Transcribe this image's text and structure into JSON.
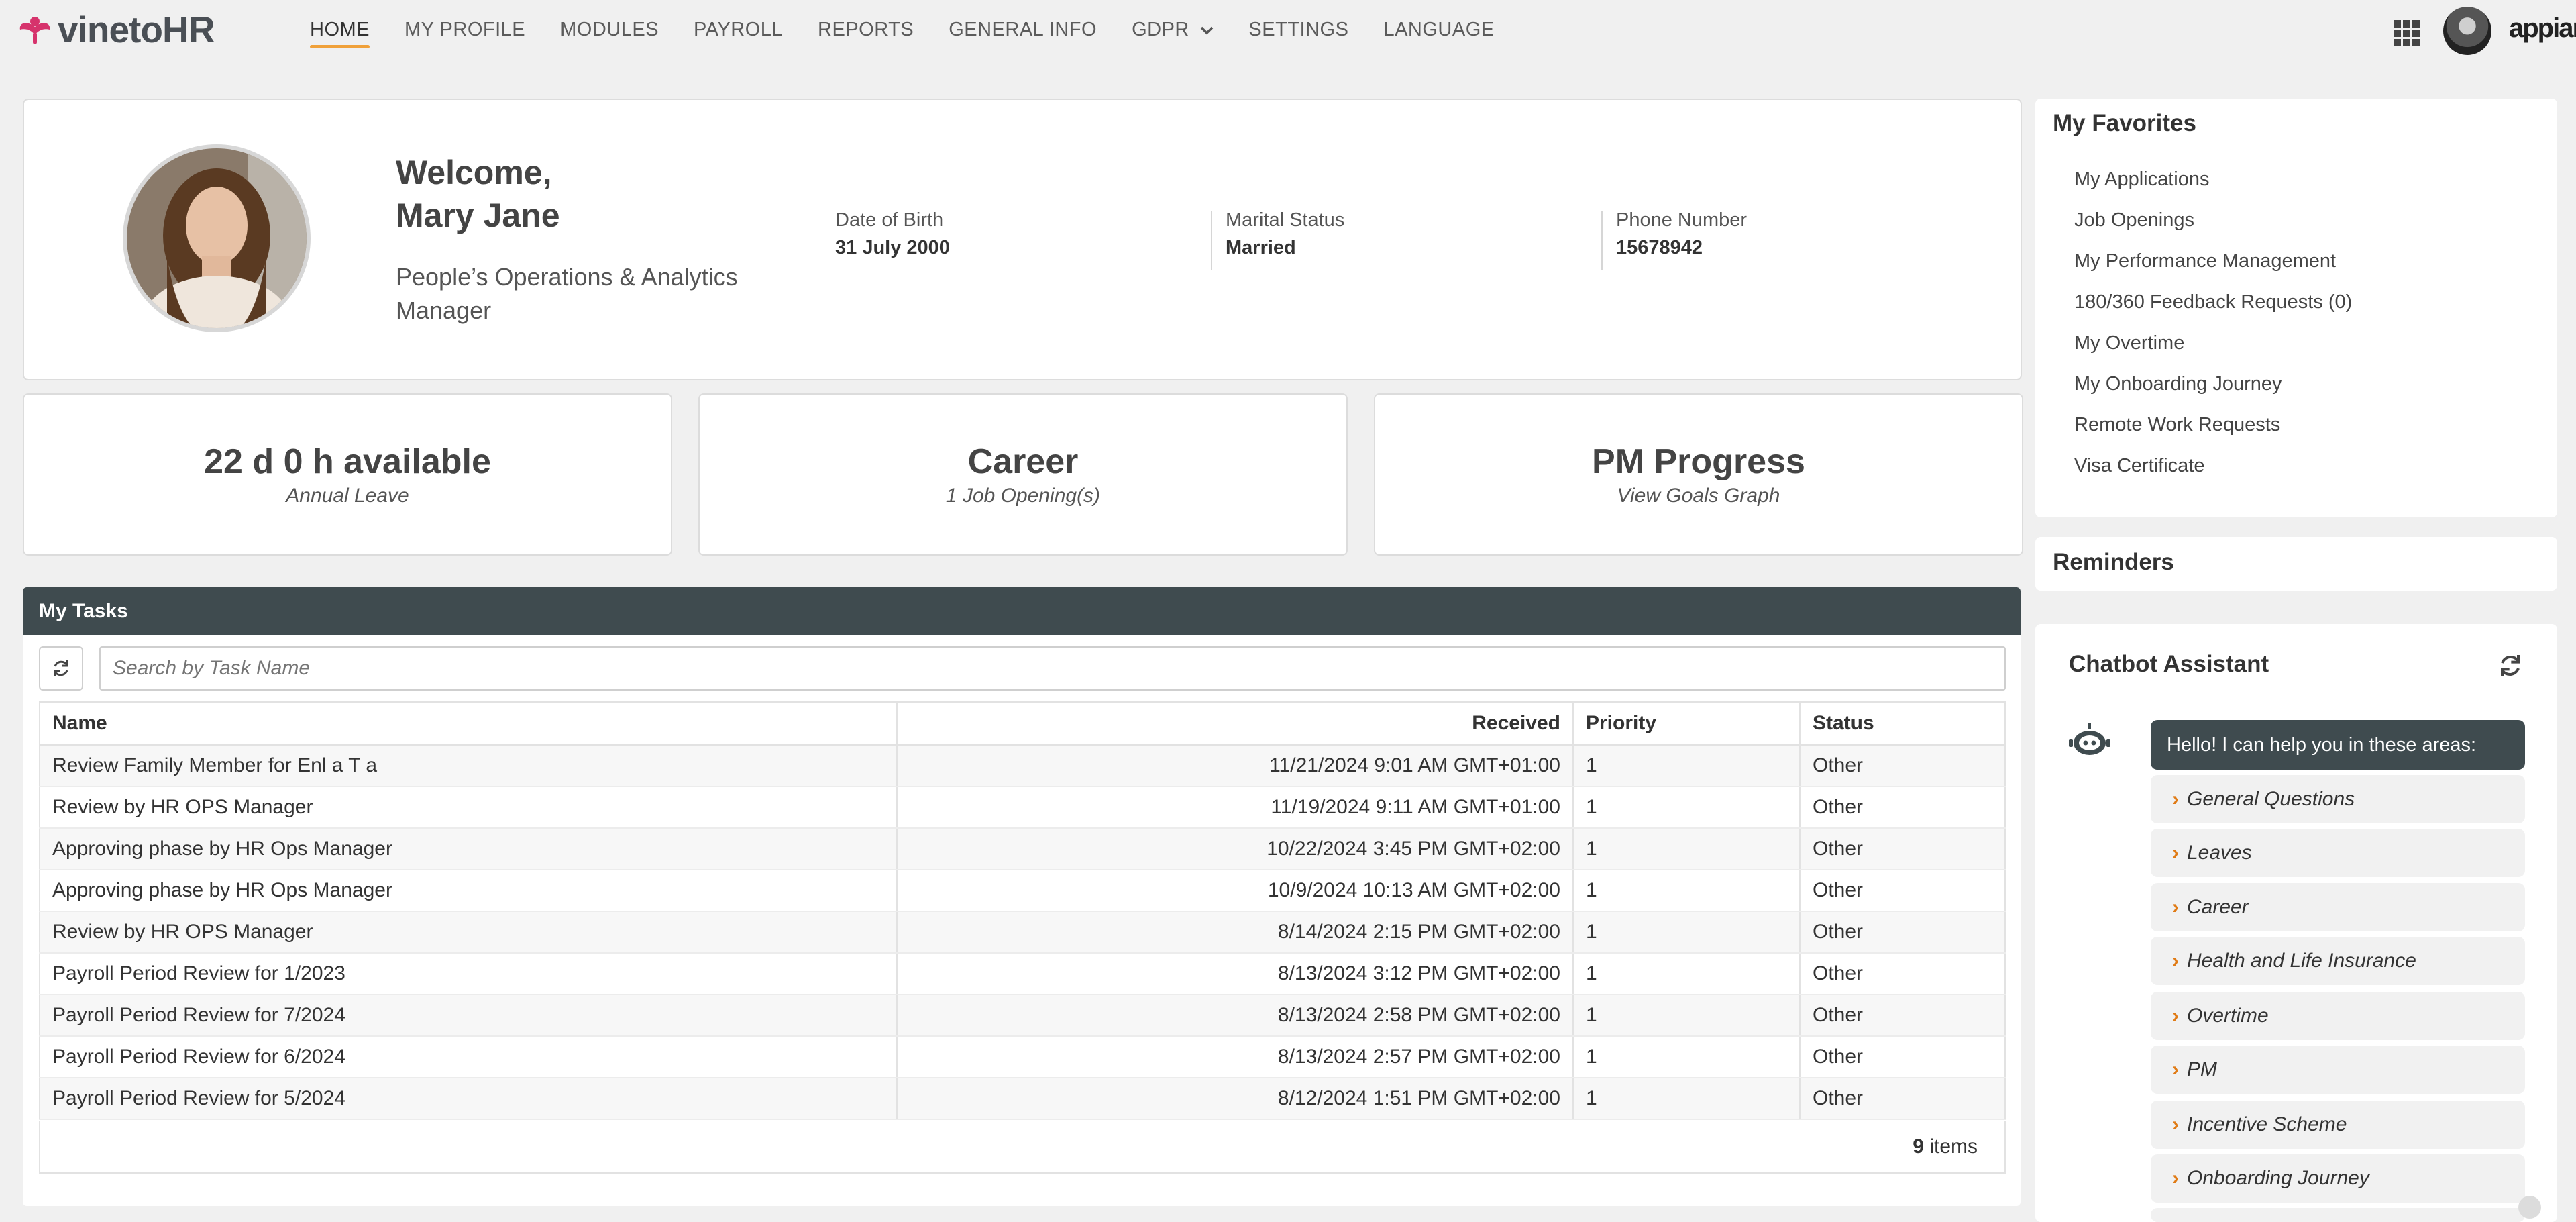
{
  "brand": {
    "name_part1": "vineto",
    "name_part2": "HR",
    "vendor": "appian"
  },
  "nav": [
    {
      "label": "HOME",
      "active": true
    },
    {
      "label": "MY PROFILE"
    },
    {
      "label": "MODULES"
    },
    {
      "label": "PAYROLL"
    },
    {
      "label": "REPORTS"
    },
    {
      "label": "GENERAL INFO"
    },
    {
      "label": "GDPR"
    },
    {
      "label": "SETTINGS"
    },
    {
      "label": "LANGUAGE"
    }
  ],
  "profile": {
    "welcome_line1": "Welcome,",
    "welcome_line2": "Mary Jane",
    "job_title": "People’s Operations & Analytics Manager",
    "fields": [
      {
        "label": "Date of Birth",
        "value": "31 July 2000"
      },
      {
        "label": "Marital Status",
        "value": "Married"
      },
      {
        "label": "Phone Number",
        "value": "15678942"
      }
    ]
  },
  "stats": [
    {
      "title": "22 d 0 h available",
      "subtitle": "Annual Leave"
    },
    {
      "title": "Career",
      "subtitle": "1 Job Opening(s)"
    },
    {
      "title": "PM Progress",
      "subtitle": "View Goals Graph"
    }
  ],
  "tasks": {
    "header": "My Tasks",
    "search_placeholder": "Search by Task Name",
    "columns": [
      "Name",
      "Received",
      "Priority",
      "Status"
    ],
    "rows": [
      {
        "name": "Review Family Member for Enl      a T   a",
        "received": "11/21/2024 9:01 AM GMT+01:00",
        "priority": "1",
        "status": "Other"
      },
      {
        "name": "Review by HR OPS Manager",
        "received": "11/19/2024 9:11 AM GMT+01:00",
        "priority": "1",
        "status": "Other"
      },
      {
        "name": "Approving phase by HR Ops Manager",
        "received": "10/22/2024 3:45 PM GMT+02:00",
        "priority": "1",
        "status": "Other"
      },
      {
        "name": "Approving phase by HR Ops Manager",
        "received": "10/9/2024 10:13 AM GMT+02:00",
        "priority": "1",
        "status": "Other"
      },
      {
        "name": "Review by HR OPS Manager",
        "received": "8/14/2024 2:15 PM GMT+02:00",
        "priority": "1",
        "status": "Other"
      },
      {
        "name": "Payroll Period Review for 1/2023",
        "received": "8/13/2024 3:12 PM GMT+02:00",
        "priority": "1",
        "status": "Other"
      },
      {
        "name": "Payroll Period Review for 7/2024",
        "received": "8/13/2024 2:58 PM GMT+02:00",
        "priority": "1",
        "status": "Other"
      },
      {
        "name": "Payroll Period Review for 6/2024",
        "received": "8/13/2024 2:57 PM GMT+02:00",
        "priority": "1",
        "status": "Other"
      },
      {
        "name": "Payroll Period Review for 5/2024",
        "received": "8/12/2024 1:51 PM GMT+02:00",
        "priority": "1",
        "status": "Other"
      }
    ],
    "count": "9",
    "count_label": "items"
  },
  "favorites": {
    "title": "My Favorites",
    "items": [
      "My Applications",
      "Job Openings",
      "My Performance Management",
      "180/360 Feedback Requests (0)",
      "My Overtime",
      "My Onboarding Journey",
      "Remote Work Requests",
      "Visa Certificate"
    ]
  },
  "reminders": {
    "title": "Reminders"
  },
  "chatbot": {
    "title": "Chatbot Assistant",
    "greeting": "Hello! I can help you in these areas:",
    "options": [
      "General Questions",
      "Leaves",
      "Career",
      "Health and Life Insurance",
      "Overtime",
      "PM",
      "Incentive Scheme",
      "Onboarding Journey"
    ]
  },
  "colors": {
    "accent": "#f0a13a",
    "brand_pink": "#d6336c",
    "dark_header": "#3f4b4f",
    "chat_arrow": "#e07b16"
  }
}
